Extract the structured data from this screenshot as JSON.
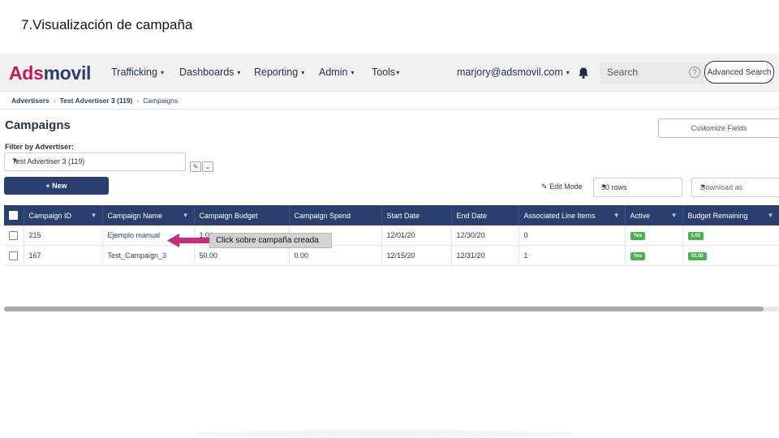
{
  "slide": {
    "title": "7.Visualización de campaña"
  },
  "logo": {
    "part1": "Ads",
    "part2": "movil"
  },
  "nav": {
    "items": [
      {
        "label": "Trafficking",
        "caret": "▾"
      },
      {
        "label": "Dashboards",
        "caret": "▾"
      },
      {
        "label": "Reporting",
        "caret": "▾"
      },
      {
        "label": "Admin",
        "caret": "▾"
      },
      {
        "label": "Tools",
        "caret": "▾"
      }
    ],
    "user": "marjory@adsmovil.com",
    "search_placeholder": "Search",
    "advanced_search": "Advanced Search"
  },
  "breadcrumb": {
    "items": [
      "Advertisers",
      "Test Advertiser 3 (119)",
      "Campaigns"
    ]
  },
  "page": {
    "title": "Campaigns",
    "customize_fields": "Customize Fields",
    "filter_label": "Filter by Advertiser:",
    "filter_value": "Test Advertiser 3 (119)",
    "new_button": "+ New",
    "edit_mode": "Edit Mode",
    "rows_value": "50 rows",
    "download_placeholder": "Download as"
  },
  "table": {
    "columns": [
      "Campaign ID",
      "Campaign Name",
      "Campaign Budget",
      "Campaign Spend",
      "Start Date",
      "End Date",
      "Associated Line Items",
      "Active",
      "Budget Remaining"
    ],
    "rows": [
      {
        "id": "215",
        "name": "Ejemplo manual",
        "budget": "1.00",
        "spend": "",
        "start": "12/01/20",
        "end": "12/30/20",
        "line_items": "0",
        "active": "Yes",
        "remaining": "1.00"
      },
      {
        "id": "167",
        "name": "Test_Campaign_3",
        "budget": "50.00",
        "spend": "0.00",
        "start": "12/15/20",
        "end": "12/31/20",
        "line_items": "1",
        "active": "Yes",
        "remaining": "50.00"
      }
    ]
  },
  "annotation": {
    "text": "Click sobre campaña creada",
    "color": "#c2307a"
  },
  "colors": {
    "brand_pink": "#c2185b",
    "brand_navy": "#2b3f6e",
    "status_green": "#4caf50"
  }
}
